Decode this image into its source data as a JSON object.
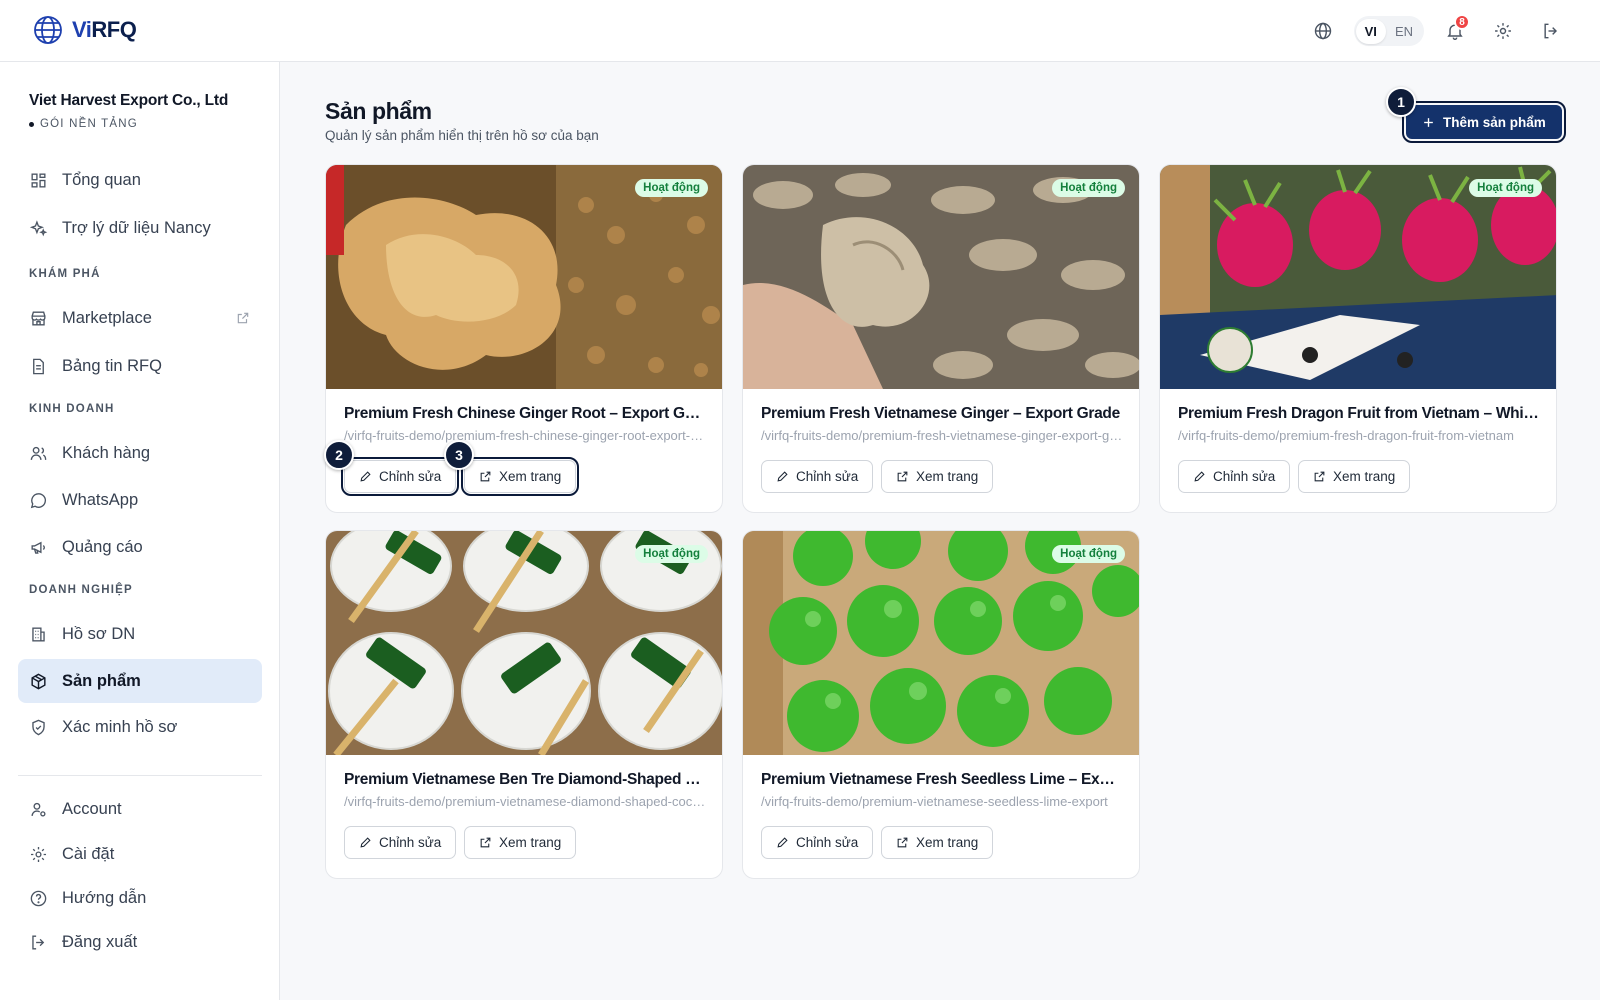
{
  "header": {
    "logo_vi": "Vi",
    "logo_rfq": "RFQ",
    "lang_vi": "VI",
    "lang_en": "EN",
    "notifications_count": "8"
  },
  "sidebar": {
    "company_name": "Viet Harvest Export Co., Ltd",
    "plan": "GÓI NỀN TẢNG",
    "items_top": [
      {
        "label": "Tổng quan",
        "icon": "dashboard-icon"
      },
      {
        "label": "Trợ lý dữ liệu Nancy",
        "icon": "sparkles-icon"
      }
    ],
    "section_explore": "KHÁM PHÁ",
    "items_explore": [
      {
        "label": "Marketplace",
        "icon": "store-icon"
      },
      {
        "label": "Bảng tin RFQ",
        "icon": "document-icon"
      }
    ],
    "section_business": "KINH DOANH",
    "items_business": [
      {
        "label": "Khách hàng",
        "icon": "users-icon"
      },
      {
        "label": "WhatsApp",
        "icon": "chat-icon"
      },
      {
        "label": "Quảng cáo",
        "icon": "megaphone-icon"
      }
    ],
    "section_enterprise": "DOANH NGHIỆP",
    "items_enterprise": [
      {
        "label": "Hồ sơ DN",
        "icon": "building-icon"
      },
      {
        "label": "Sản phẩm",
        "icon": "package-icon"
      },
      {
        "label": "Xác minh hồ sơ",
        "icon": "shield-check-icon"
      }
    ],
    "items_bottom": [
      {
        "label": "Account",
        "icon": "user-gear-icon"
      },
      {
        "label": "Cài đặt",
        "icon": "gear-icon"
      },
      {
        "label": "Hướng dẫn",
        "icon": "help-icon"
      },
      {
        "label": "Đăng xuất",
        "icon": "logout-icon"
      }
    ]
  },
  "main": {
    "title": "Sản phẩm",
    "subtitle": "Quản lý sản phẩm hiển thị trên hồ sơ của bạn",
    "add_button": "Thêm sản phẩm",
    "edit_label": "Chỉnh sửa",
    "view_label": "Xem trang",
    "products": [
      {
        "title": "Premium Fresh Chinese Ginger Root – Export Grade",
        "slug": "/virfq-fruits-demo/premium-fresh-chinese-ginger-root-export-grade",
        "status": "Hoạt động"
      },
      {
        "title": "Premium Fresh Vietnamese Ginger – Export Grade",
        "slug": "/virfq-fruits-demo/premium-fresh-vietnamese-ginger-export-grade",
        "status": "Hoạt động"
      },
      {
        "title": "Premium Fresh Dragon Fruit from Vietnam – White Flesh",
        "slug": "/virfq-fruits-demo/premium-fresh-dragon-fruit-from-vietnam",
        "status": "Hoạt động"
      },
      {
        "title": "Premium Vietnamese Ben Tre Diamond-Shaped Coconut",
        "slug": "/virfq-fruits-demo/premium-vietnamese-diamond-shaped-coconut",
        "status": "Hoạt động"
      },
      {
        "title": "Premium Vietnamese Fresh Seedless Lime – Export Grade",
        "slug": "/virfq-fruits-demo/premium-vietnamese-seedless-lime-export",
        "status": "Hoạt động"
      }
    ]
  },
  "markers": [
    "1",
    "2",
    "3"
  ],
  "colors": {
    "accent": "#14326b",
    "active_nav": "#e1ebf9",
    "status_bg": "#dcfce7",
    "status_text": "#15803d",
    "badge": "#ef4444"
  }
}
